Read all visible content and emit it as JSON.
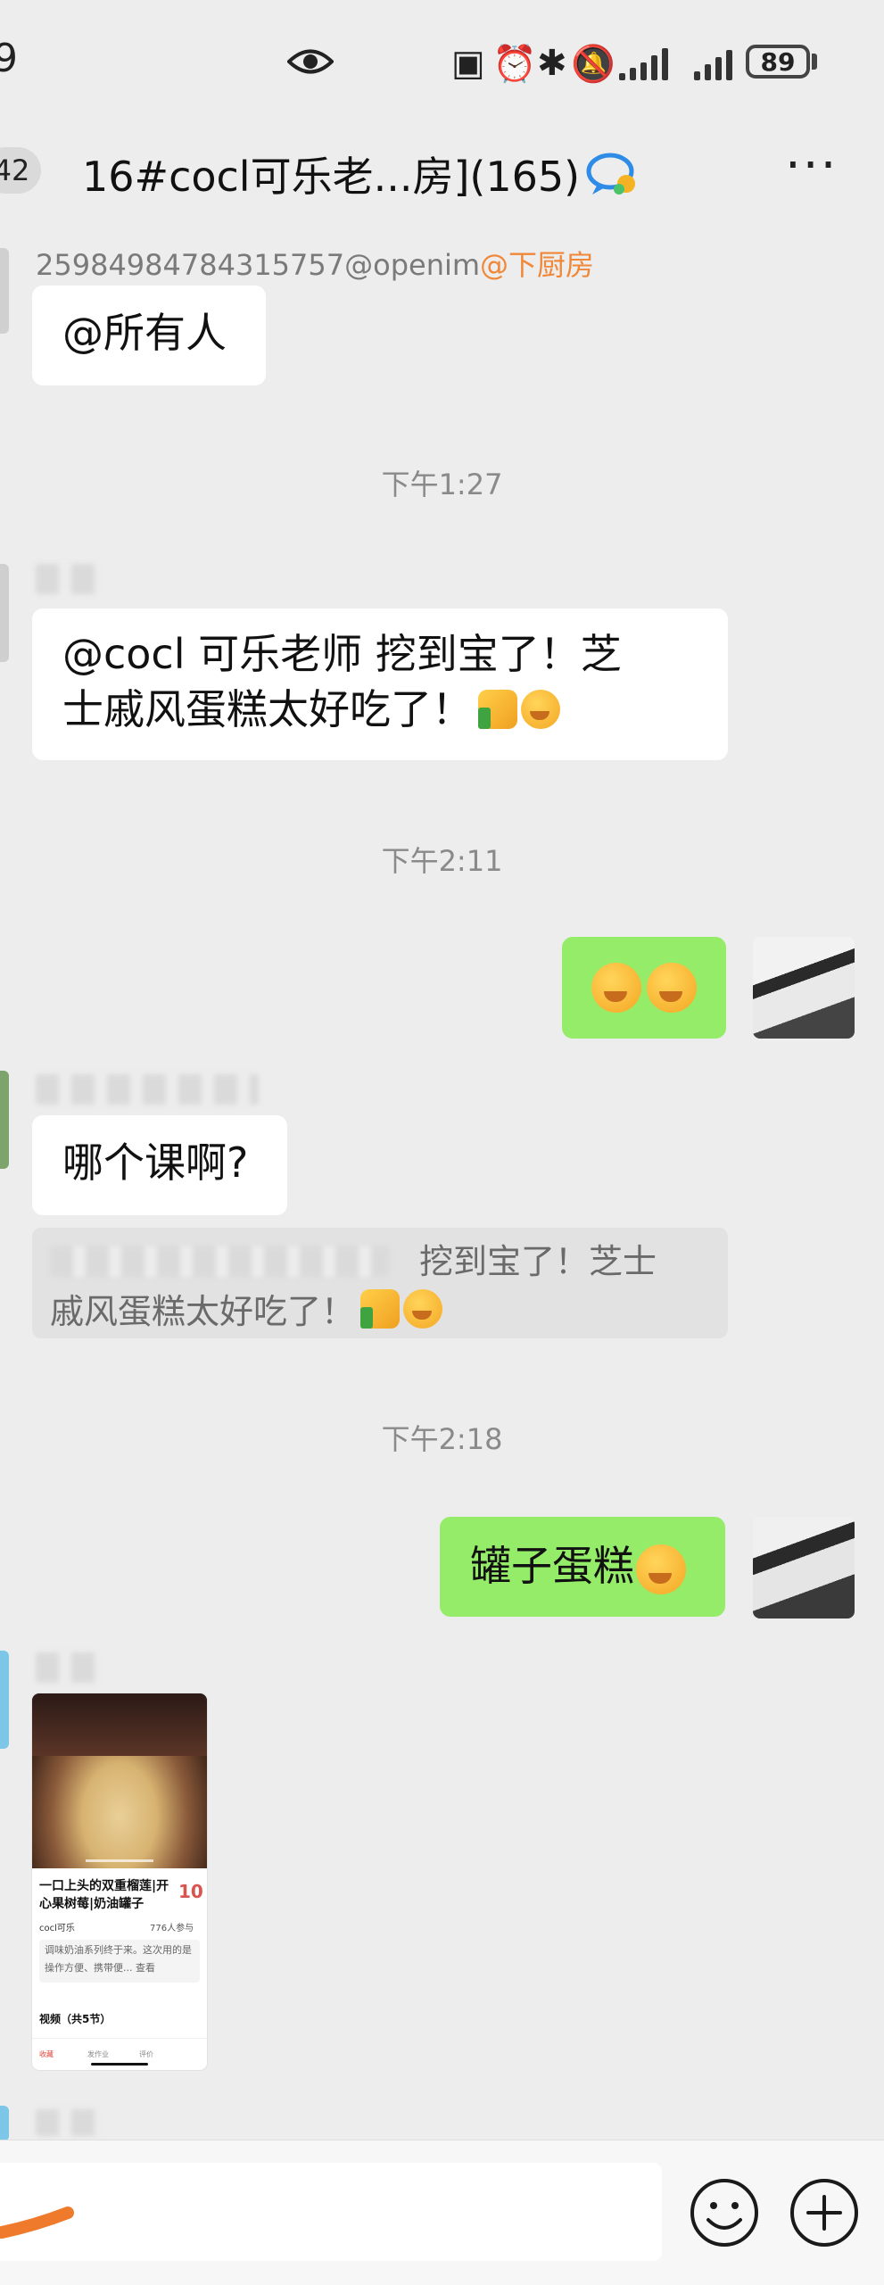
{
  "status_bar": {
    "time": "9",
    "battery": "89",
    "icons": [
      "eye-icon",
      "nfc-icon",
      "alarm-icon",
      "bluetooth-icon",
      "mute-icon",
      "signal-icon",
      "signal-icon"
    ]
  },
  "header": {
    "unread_count": "42",
    "title": "16#cocl可乐老...房](165)",
    "more": "···"
  },
  "messages": {
    "m1_sender": "25984984784315757@openim",
    "m1_sender_tag": "@下厨房",
    "m1_text": "@所有人",
    "time1": "下午1:27",
    "m2_line1": "@cocl 可乐老师      挖到宝了！芝",
    "m2_line2": "士戚风蛋糕太好吃了！",
    "time2": "下午2:11",
    "time3": "下午2:18",
    "m4_text": "哪个课啊?",
    "quote_line1": "挖到宝了！芝士",
    "quote_line2": "戚风蛋糕太好吃了！",
    "m5_text": "罐子蛋糕"
  },
  "card": {
    "title": "一口上头的双重榴莲|开心果树莓|奶油罐子",
    "count": "10",
    "author": "cocl可乐",
    "participants": "776人参与",
    "desc": "调味奶油系列终于来。这次用的是操作方便、携带便... 查看",
    "section": "视频（共5节）",
    "bar_items": [
      "收藏",
      "发作业",
      "评价"
    ]
  },
  "colors": {
    "background": "#ededed",
    "own_bubble": "#95ec69",
    "mention": "#f0883a"
  }
}
